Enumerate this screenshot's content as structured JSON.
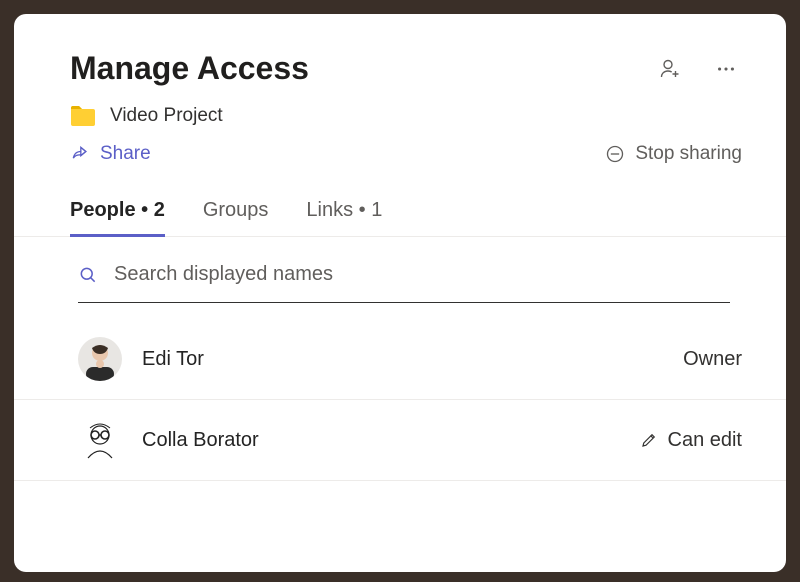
{
  "header": {
    "title": "Manage Access",
    "folder_name": "Video Project",
    "share_label": "Share",
    "stop_sharing_label": "Stop sharing"
  },
  "tabs": {
    "people_label": "People • 2",
    "groups_label": "Groups",
    "links_label": "Links • 1"
  },
  "search": {
    "placeholder": "Search displayed names"
  },
  "people": [
    {
      "name": "Edi Tor",
      "role": "Owner",
      "editable": false
    },
    {
      "name": "Colla Borator",
      "role": "Can edit",
      "editable": true
    }
  ],
  "icons": {
    "add_person": "add-person-icon",
    "more": "more-icon",
    "folder": "folder-icon",
    "share": "share-icon",
    "stop": "stop-icon",
    "search": "search-icon",
    "pencil": "pencil-icon"
  },
  "colors": {
    "accent": "#5b5fc7",
    "muted": "#605e5c"
  }
}
